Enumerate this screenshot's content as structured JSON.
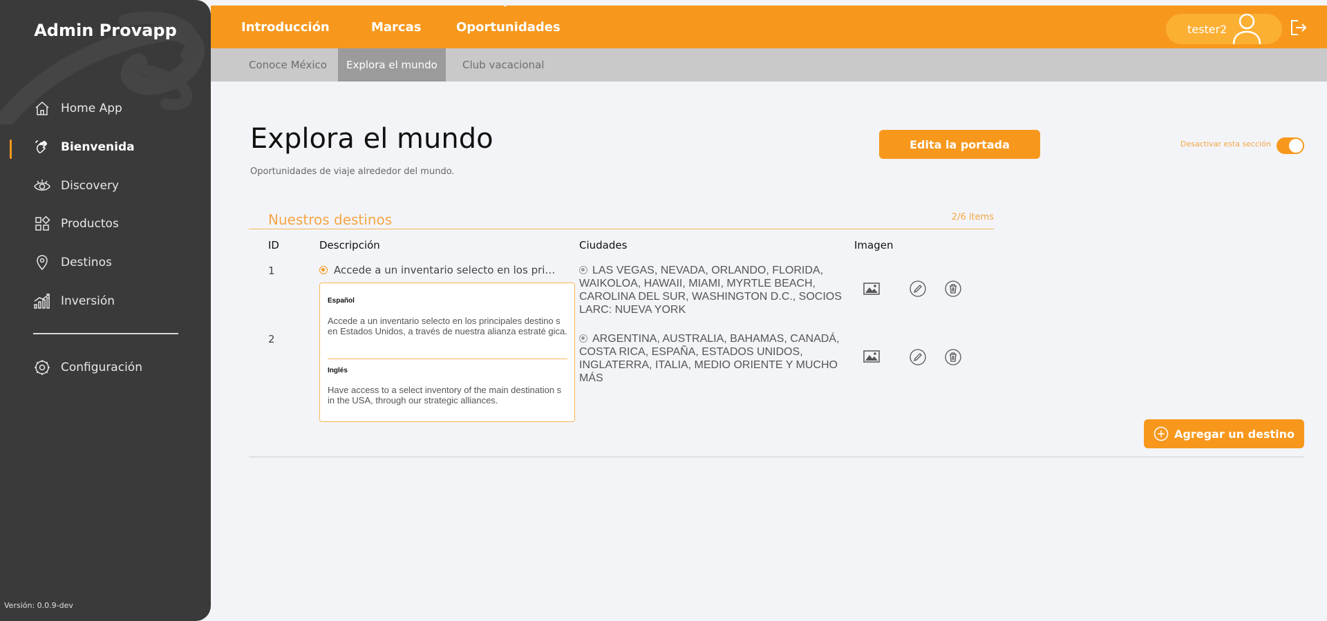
{
  "sidebar": {
    "brand": "Admin Provapp",
    "items": [
      {
        "label": "Home App",
        "icon": "home-icon"
      },
      {
        "label": "Bienvenida",
        "icon": "waving-hand-icon",
        "active": true
      },
      {
        "label": "Discovery",
        "icon": "eye-icon"
      },
      {
        "label": "Productos",
        "icon": "grid-icon"
      },
      {
        "label": "Destinos",
        "icon": "location-pin-icon"
      },
      {
        "label": "Inversión",
        "icon": "chart-bars-icon"
      },
      {
        "label": "Configuración",
        "icon": "gear-icon"
      }
    ],
    "version": "Versión: 0.0.9-dev"
  },
  "topbar": {
    "tabs": [
      "Introducción",
      "Marcas",
      "Oportunidades"
    ],
    "active_tab": "Oportunidades",
    "user": "tester2",
    "accent": "#f7981d"
  },
  "subtabs": {
    "items": [
      "Conoce México",
      "Explora el mundo",
      "Club vacacional"
    ],
    "active": "Explora el mundo"
  },
  "page": {
    "title": "Explora el mundo",
    "subtitle": "Oportunidades de viaje alrededor del mundo.",
    "edit_cover": "Edita la portada",
    "toggle_label": "Desactivar esta sección",
    "toggle_on": true
  },
  "section": {
    "title": "Nuestros destinos",
    "count": "2/6 items",
    "columns": {
      "id": "ID",
      "description": "Descripción",
      "cities": "Ciudades",
      "image": "Imagen"
    },
    "rows": [
      {
        "id": "1",
        "description": "Accede a un inventario selecto en los princi...",
        "cities": "LAS VEGAS, NEVADA, ORLANDO, FLORIDA, WAIKOLOA, HAWAII, MIAMI, MYRTLE BEACH, CAROLINA DEL SUR, WASHINGTON D.C., SOCIOS LARC: NUEVA YORK"
      },
      {
        "id": "2",
        "description": "",
        "cities": "ARGENTINA, AUSTRALIA, BAHAMAS, CANADÁ, COSTA RICA, ESPAÑA, ESTADOS UNIDOS, INGLATERRA, ITALIA, MEDIO ORIENTE Y MUCHO MÁS"
      }
    ],
    "popup": {
      "es_label": "Español",
      "es_text": "Accede a un inventario selecto en los principales destino s en Estados Unidos, a través de nuestra alianza estraté gica.",
      "en_label": "Inglés",
      "en_text": "Have access to a select inventory of the main destination s in the USA, through our strategic alliances."
    },
    "add_button": "Agregar un destino"
  }
}
